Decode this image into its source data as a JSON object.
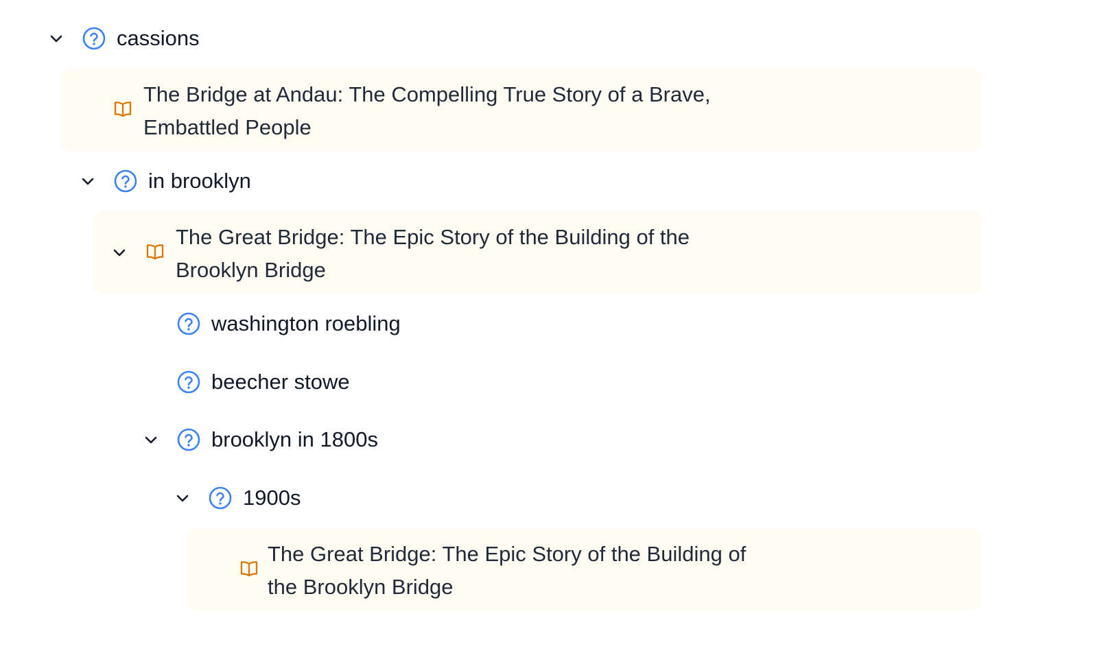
{
  "colors": {
    "query_icon": "#3b82f6",
    "book_icon": "#d97706",
    "book_bg": "#fffcf3",
    "chevron": "#111827"
  },
  "icons": {
    "chevron": "chevron-down-icon",
    "query": "question-circle-icon",
    "book": "open-book-icon"
  },
  "tree": {
    "cassions": "cassions",
    "book_andau": "The Bridge at Andau: The Compelling True Story of a Brave, Embattled People",
    "in_brooklyn": "in brooklyn",
    "book_great_bridge_1": "The Great Bridge: The Epic Story of the Building of the Brooklyn Bridge",
    "washington_roebling": "washington roebling",
    "beecher_stowe": "beecher stowe",
    "brooklyn_1800s": "brooklyn in 1800s",
    "y1900s": "1900s",
    "book_great_bridge_2": "The Great Bridge: The Epic Story of the Building of the Brooklyn Bridge"
  }
}
